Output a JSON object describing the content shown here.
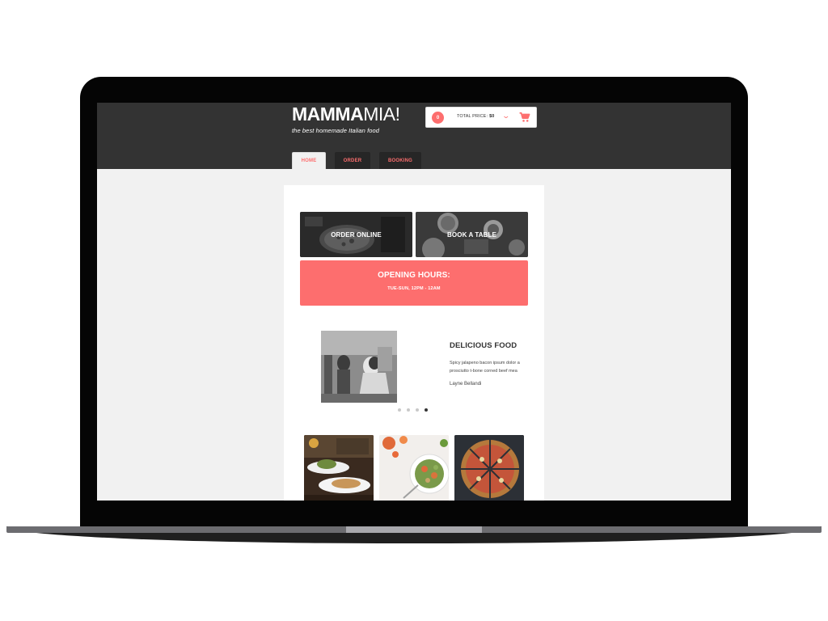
{
  "header": {
    "logo_bold": "MAMMA",
    "logo_light": "MIA!",
    "tagline": "the best homemade Italian food"
  },
  "cart": {
    "count": "0",
    "total_label": "TOTAL PRICE:",
    "total_value": "$0"
  },
  "nav": {
    "tabs": [
      {
        "label": "HOME",
        "active": true
      },
      {
        "label": "ORDER",
        "active": false
      },
      {
        "label": "BOOKING",
        "active": false
      }
    ]
  },
  "tiles": {
    "order_label": "ORDER ONLINE",
    "book_label": "BOOK A TABLE"
  },
  "opening_hours": {
    "title": "OPENING HOURS:",
    "time": "TUE-SUN, 12PM - 12AM"
  },
  "testimonial": {
    "title": "DELICIOUS FOOD",
    "line1": "Spicy jalapeno bacon ipsum dolor a",
    "line2": "prosciutto t-bone corned beef mea",
    "author": "Layne Bellandi"
  },
  "carousel": {
    "dot_count": 4,
    "active_index": 3
  },
  "colors": {
    "accent": "#fd6e6e",
    "header_bg": "#333333",
    "page_bg": "#f1f1f1"
  },
  "icons": [
    "cart-icon",
    "chevron-down-icon"
  ]
}
